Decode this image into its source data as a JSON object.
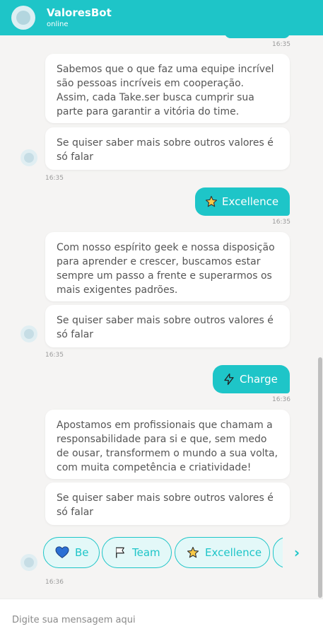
{
  "header": {
    "bot_name": "ValoresBot",
    "status": "online"
  },
  "messages": {
    "m1": {
      "text": "Sabemos que o que faz uma equipe incrível são pessoas incríveis em cooperação. Assim, cada Take.ser busca cumprir sua parte para garantir a vitória do time.",
      "followup": "Se quiser saber mais sobre outros valores é só falar"
    },
    "m2": {
      "text": "Com nosso espírito geek e nossa disposição para aprender e crescer, buscamos estar sempre um passo a frente e superarmos os mais exigentes padrões.",
      "followup": "Se quiser saber mais sobre outros valores é só falar"
    },
    "m3": {
      "text": "Apostamos em profissionais que chamam a responsabilidade para si e que, sem medo de ousar, transformem o mundo a sua volta, com muita competência e criatividade!",
      "followup": "Se quiser saber mais sobre outros valores é só falar"
    }
  },
  "user_messages": {
    "u1": {
      "label": "Excellence",
      "icon": "star-icon"
    },
    "u2": {
      "label": "Charge",
      "icon": "lightning-icon"
    }
  },
  "timestamps": {
    "t0": "16:35",
    "t1": "16:35",
    "t2": "16:35",
    "t3": "16:35",
    "t4": "16:36",
    "t5": "16:36"
  },
  "quick_replies": [
    {
      "label": "Be",
      "icon": "heart-icon"
    },
    {
      "label": "Team",
      "icon": "flag-icon"
    },
    {
      "label": "Excellence",
      "icon": "star-icon"
    }
  ],
  "input": {
    "placeholder": "Digite sua mensagem aqui"
  },
  "colors": {
    "accent": "#1ec5c8",
    "background": "#f5f4f3",
    "bubble": "#ffffff"
  }
}
